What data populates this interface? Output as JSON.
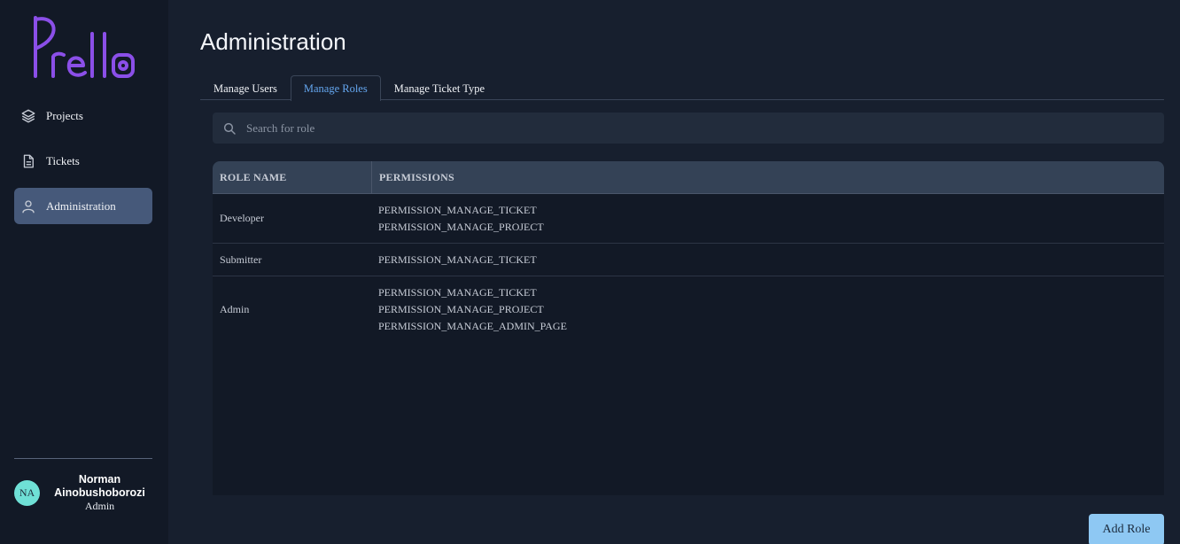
{
  "app": {
    "logo_text": "Prello"
  },
  "sidebar": {
    "items": [
      {
        "label": "Projects",
        "icon": "layers-icon"
      },
      {
        "label": "Tickets",
        "icon": "document-icon"
      },
      {
        "label": "Administration",
        "icon": "user-icon",
        "active": true
      }
    ]
  },
  "user": {
    "initials": "NA",
    "first_name": "Norman",
    "last_name": "Ainobushoborozi",
    "role": "Admin"
  },
  "page": {
    "title": "Administration"
  },
  "tabs": [
    {
      "label": "Manage Users"
    },
    {
      "label": "Manage Roles",
      "active": true
    },
    {
      "label": "Manage Ticket Type"
    }
  ],
  "search": {
    "placeholder": "Search for role",
    "value": ""
  },
  "table": {
    "headers": [
      "ROLE NAME",
      "PERMISSIONS"
    ],
    "rows": [
      {
        "role": "Developer",
        "permissions": [
          "PERMISSION_MANAGE_TICKET",
          "PERMISSION_MANAGE_PROJECT"
        ]
      },
      {
        "role": "Submitter",
        "permissions": [
          "PERMISSION_MANAGE_TICKET"
        ]
      },
      {
        "role": "Admin",
        "permissions": [
          "PERMISSION_MANAGE_TICKET",
          "PERMISSION_MANAGE_PROJECT",
          "PERMISSION_MANAGE_ADMIN_PAGE"
        ]
      }
    ]
  },
  "actions": {
    "add_role_label": "Add Role"
  },
  "colors": {
    "background": "#171f2e",
    "sidebar": "#121926",
    "accent": "#64a6ef",
    "logo": "#8b4fe8",
    "button": "#8ec8f3",
    "avatar": "#6fe0d6"
  }
}
